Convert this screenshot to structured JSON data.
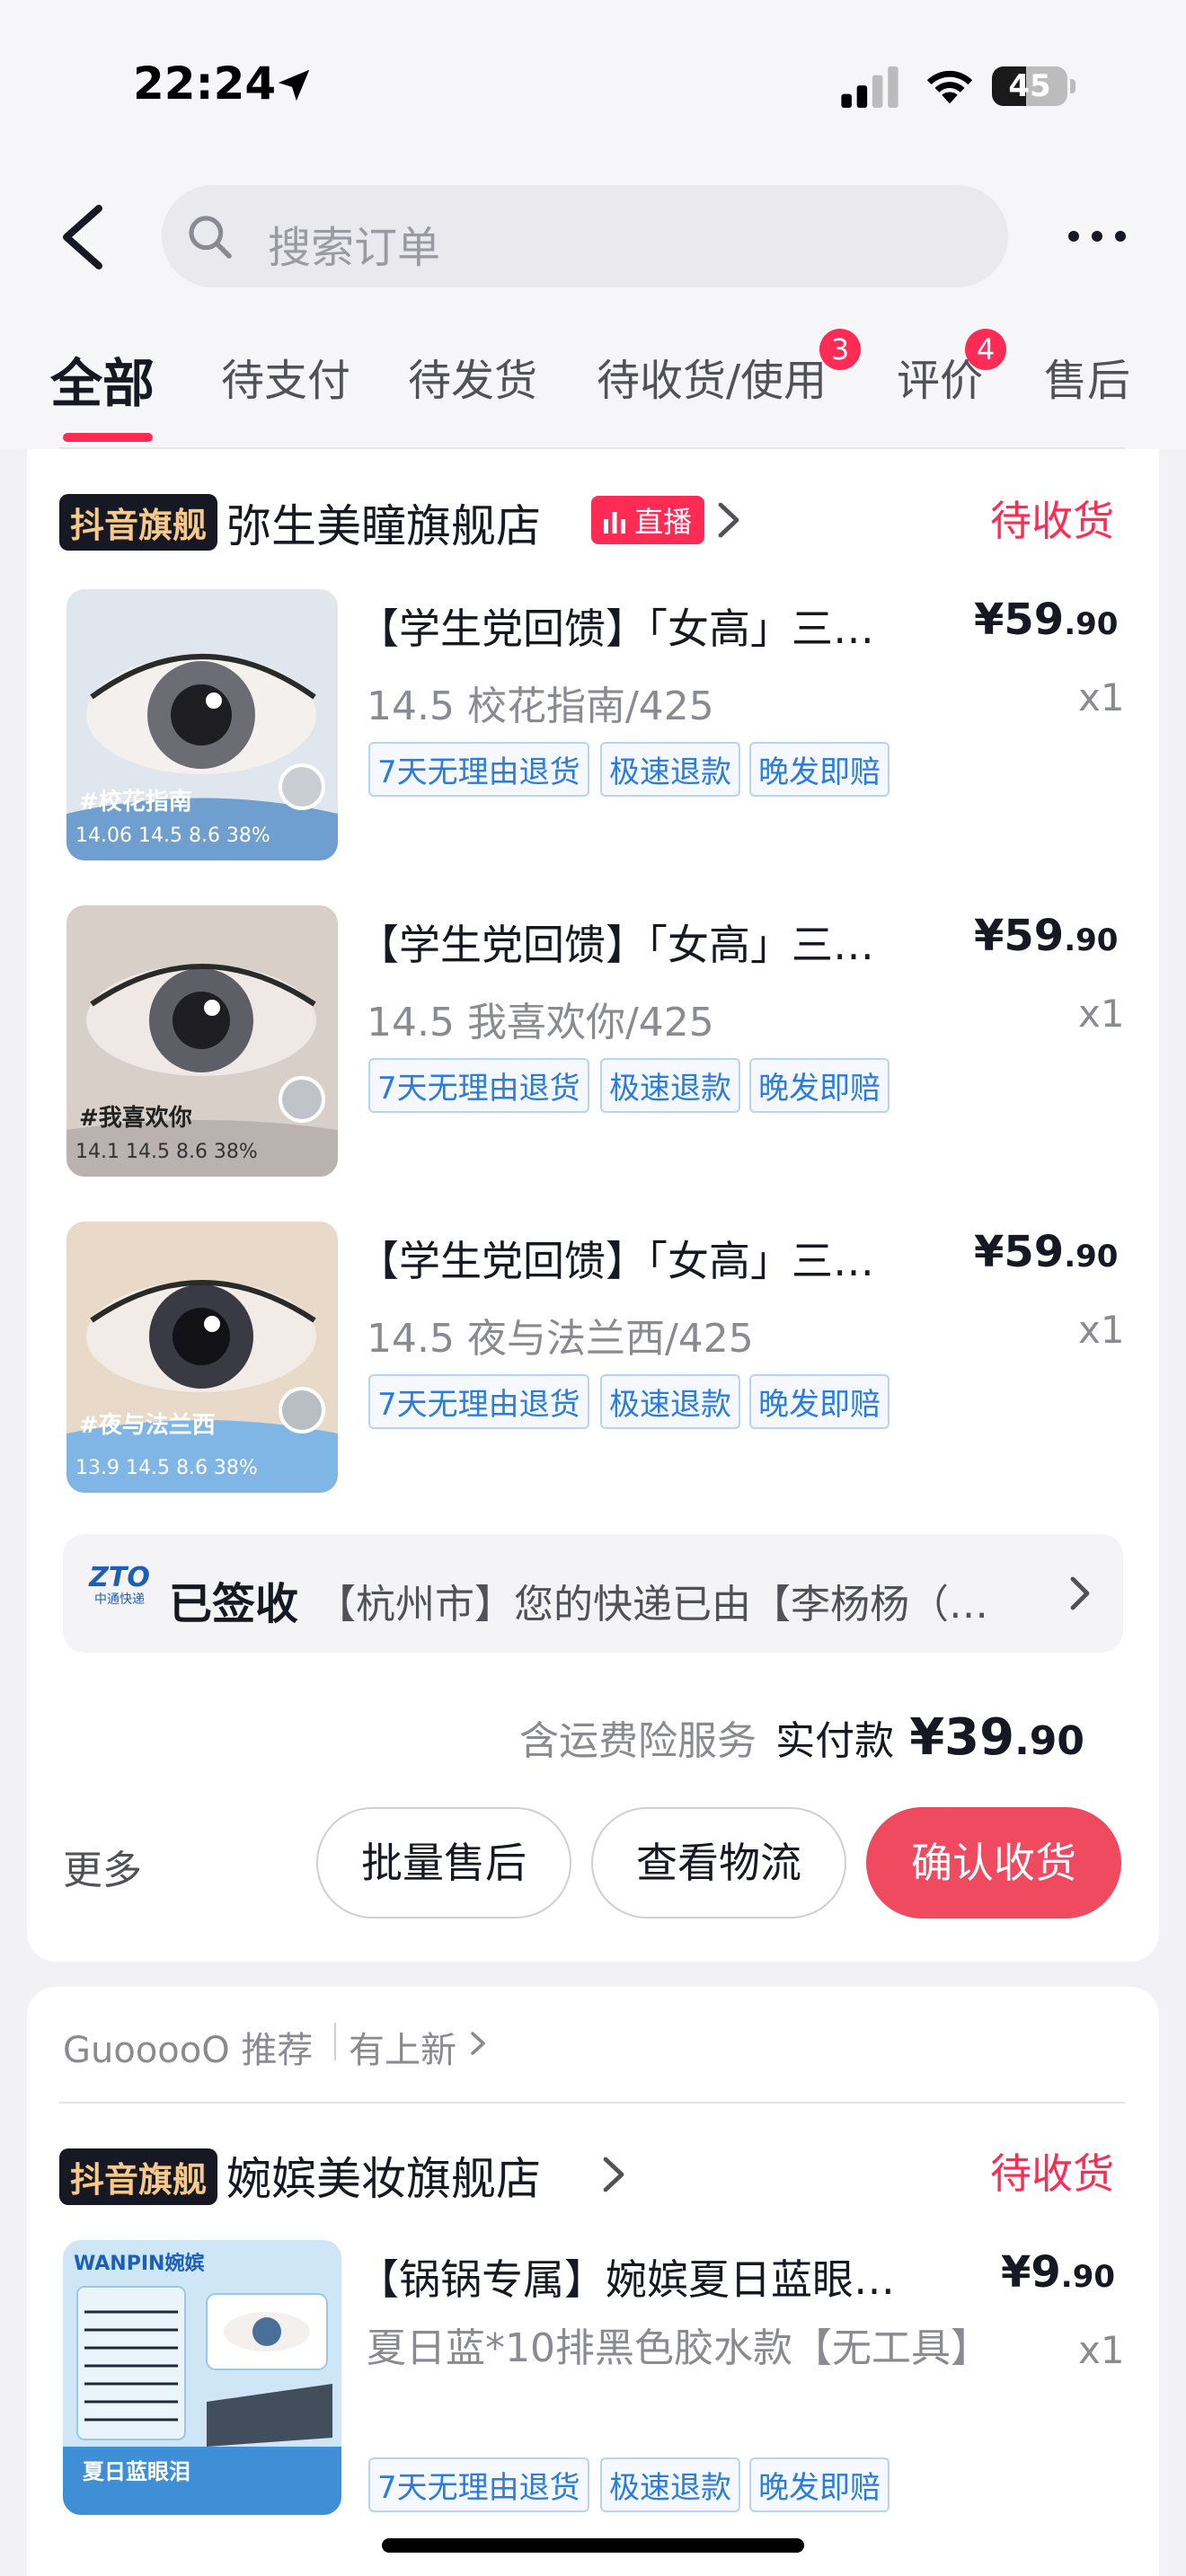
{
  "status_bar": {
    "time": "22:24",
    "battery": "45",
    "battery_level": 0.45
  },
  "search": {
    "placeholder": "搜索订单"
  },
  "tabs": [
    {
      "label": "全部",
      "active": true
    },
    {
      "label": "待支付"
    },
    {
      "label": "待发货"
    },
    {
      "label": "待收货/使用",
      "badge": "3"
    },
    {
      "label": "评价",
      "badge": "4"
    },
    {
      "label": "售后"
    }
  ],
  "order1": {
    "store_badge": "抖音旗舰",
    "store_name": "弥生美瞳旗舰店",
    "live_badge": "直播",
    "status": "待收货",
    "items": [
      {
        "title": "【学生党回馈】「女高」三明治美瞳",
        "spec": "14.5 校花指南/425",
        "price_yen": "¥59",
        "price_cents": ".90",
        "qty": "x1",
        "thumb_label": "#校花指南",
        "thumb_specs": "14.06 14.5 8.6 38%"
      },
      {
        "title": "【学生党回馈】「女高」三明治美瞳",
        "spec": "14.5 我喜欢你/425",
        "price_yen": "¥59",
        "price_cents": ".90",
        "qty": "x1",
        "thumb_label": "#我喜欢你",
        "thumb_specs": "14.1 14.5 8.6 38%"
      },
      {
        "title": "【学生党回馈】「女高」三明治美瞳",
        "spec": "14.5 夜与法兰西/425",
        "price_yen": "¥59",
        "price_cents": ".90",
        "qty": "x1",
        "thumb_label": "#夜与法兰西",
        "thumb_specs": "13.9 14.5 8.6 38%"
      }
    ],
    "tags": [
      "7天无理由退货",
      "极速退款",
      "晚发即赔"
    ],
    "logistics": {
      "carrier_logo": "ZTO",
      "carrier_name": "中通快递",
      "status": "已签收",
      "message": "【杭州市】您的快递已由【李杨杨（…"
    },
    "summary": {
      "insurance": "含运费险服务",
      "paid_label": "实付款",
      "paid_yen": "¥39",
      "paid_cents": ".90"
    },
    "more_label": "更多",
    "buttons": [
      "批量售后",
      "查看物流",
      "确认收货"
    ]
  },
  "recommend": {
    "user": "GuooooO 推荐",
    "link": "有上新"
  },
  "order2": {
    "store_badge": "抖音旗舰",
    "store_name": "婉嫔美妆旗舰店",
    "status": "待收货",
    "item": {
      "title": "【锅锅专属】婉嫔夏日蓝眼泪假睫毛",
      "spec": "夏日蓝*10排黑色胶水款【无工具】",
      "price_yen": "¥9",
      "price_cents": ".90",
      "qty": "x1",
      "thumb_brand": "WANPIN婉嫔",
      "thumb_caption": "夏日蓝眼泪"
    },
    "tags": [
      "7天无理由退货",
      "极速退款",
      "晚发即赔"
    ]
  },
  "colors": {
    "accent": "#fe2c55",
    "tag_blue": "#2a7ce0",
    "store_badge_bg": "#161823",
    "store_badge_text": "#f6c98a"
  },
  "icons": [
    "location-arrow-icon",
    "signal-icon",
    "wifi-icon",
    "battery-icon",
    "back-icon",
    "search-icon",
    "more-icon",
    "chevron-right-icon",
    "live-icon"
  ]
}
